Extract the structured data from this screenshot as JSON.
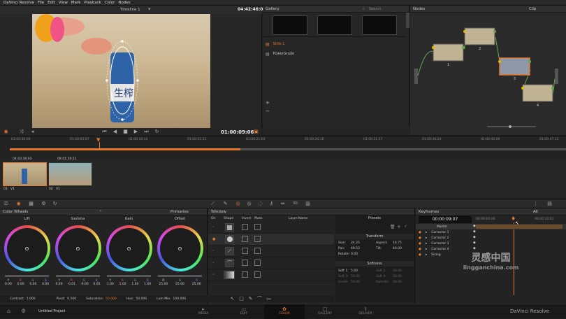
{
  "menubar": {
    "app": "DaVinci Resolve",
    "items": [
      "File",
      "Edit",
      "View",
      "Mark",
      "Playback",
      "Color",
      "Nodes"
    ]
  },
  "viewer": {
    "title": "Timeline 1",
    "timecode_top": "04:42:46:08",
    "timecode_bottom": "01:00:09:06"
  },
  "gallery": {
    "title": "Gallery",
    "search": "Search",
    "items": [
      "Stills 1",
      "PowerGrade"
    ]
  },
  "nodes": {
    "title": "Nodes",
    "mode": "Clip",
    "labels": [
      "1",
      "2",
      "3",
      "4"
    ]
  },
  "timeline": {
    "ticks": [
      "01:00:00:00",
      "01:00:05:07",
      "01:00:10:14",
      "01:00:15:21",
      "01:00:21:03",
      "01:00:26:10",
      "01:00:31:17",
      "01:00:36:24",
      "01:00:42:06",
      "01:00:47:13"
    ]
  },
  "clips": [
    {
      "tc": "04:43:36:03",
      "label": "01",
      "track": "V1"
    },
    {
      "tc": "08:41:19:21",
      "label": "02",
      "track": "V1"
    }
  ],
  "color_wheels": {
    "title": "Color Wheels",
    "mode": "Primaries",
    "wheels": [
      {
        "name": "Lift",
        "vals": [
          "0.00",
          "0.00",
          "0.00",
          "0.00"
        ]
      },
      {
        "name": "Gamma",
        "vals": [
          "0.00",
          "-0.01",
          "-0.00",
          "0.05"
        ]
      },
      {
        "name": "Gain",
        "vals": [
          "1.00",
          "1.00",
          "1.00",
          "1.00"
        ]
      },
      {
        "name": "Offset",
        "vals": [
          "25.00",
          "25.00",
          "25.00",
          "25.00"
        ]
      }
    ],
    "channels": [
      "Y",
      "R",
      "G",
      "B"
    ],
    "footer": {
      "contrast_label": "Contrast:",
      "contrast": "1.000",
      "pivot_label": "Pivot:",
      "pivot": "0.500",
      "saturation_label": "Saturation:",
      "saturation": "50.000",
      "hue_label": "Hue:",
      "hue": "50.000",
      "lummix_label": "Lum Mix:",
      "lummix": "100.000"
    }
  },
  "window": {
    "title": "Window",
    "cols": [
      "On",
      "Shape",
      "Invert",
      "Mask",
      "Layer Name"
    ],
    "presets": "Presets",
    "transform": {
      "title": "Transform",
      "size_label": "Size:",
      "size": "24.25",
      "aspect_label": "Aspect:",
      "aspect": "16.75",
      "pan_label": "Pan:",
      "pan": "49.53",
      "tilt_label": "Tilt:",
      "tilt": "40.00",
      "rotate_label": "Rotate:",
      "rotate": "0.00"
    },
    "softness": {
      "title": "Softness",
      "soft1_label": "Soft 1:",
      "soft1": "5.00",
      "soft2_label": "Soft 2:",
      "soft2": "50.00",
      "soft3_label": "Soft 3:",
      "soft3": "50.00",
      "soft4_label": "Soft 4:",
      "soft4": "50.00",
      "inside_label": "Inside:",
      "inside": "50.00",
      "outside_label": "Outside:",
      "outside": "50.00"
    }
  },
  "keyframes": {
    "title": "Keyframes",
    "mode": "All",
    "timecode": "00:00:09:07",
    "ruler": [
      "00:00:00:00",
      "00:00:10:01"
    ],
    "rows": [
      "Master",
      "Corrector 1",
      "Corrector 2",
      "Corrector 3",
      "Corrector 4",
      "Sizing"
    ]
  },
  "bottombar": {
    "project": "Untitled Project",
    "brand": "DaVinci Resolve",
    "nav": [
      "MEDIA",
      "EDIT",
      "COLOR",
      "GALLERY",
      "DELIVER"
    ]
  },
  "watermark": {
    "cn": "灵感中国",
    "url": "lingganchina.com"
  },
  "colors": {
    "accent": "#e6772e",
    "panel": "#232323"
  }
}
